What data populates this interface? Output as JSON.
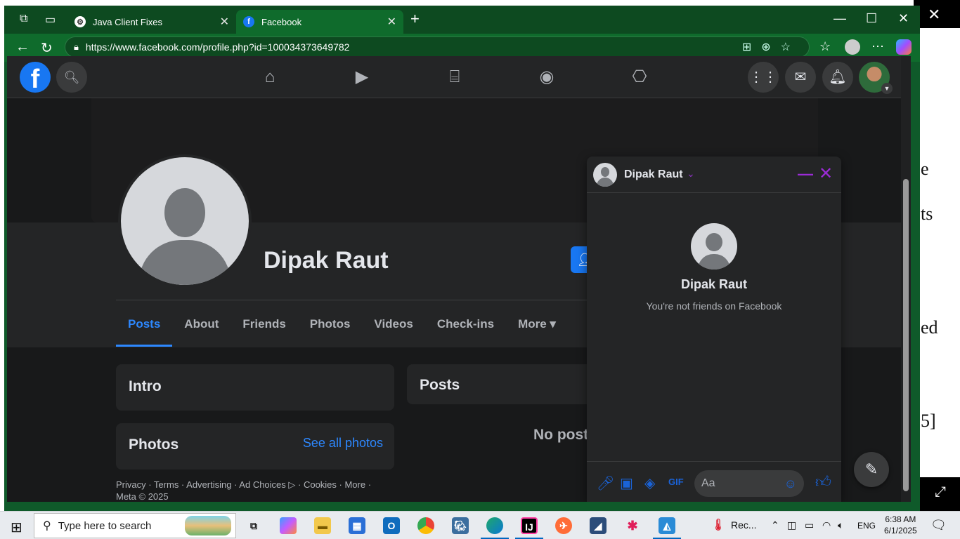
{
  "browser": {
    "tabs": [
      {
        "title": "Java Client Fixes",
        "active": false
      },
      {
        "title": "Facebook",
        "active": true
      }
    ],
    "url": "https://www.facebook.com/profile.php?id=100034373649782"
  },
  "background_doc": {
    "fragments": [
      "e",
      "ts",
      "ed",
      "5]"
    ]
  },
  "facebook": {
    "profile": {
      "name": "Dipak Raut",
      "tabs": [
        "Posts",
        "About",
        "Friends",
        "Photos",
        "Videos",
        "Check-ins",
        "More ▾"
      ]
    },
    "intro": {
      "title": "Intro"
    },
    "photos": {
      "title": "Photos",
      "see_all": "See all photos"
    },
    "posts": {
      "title": "Posts",
      "empty": "No post"
    },
    "footer": {
      "line1": "Privacy · Terms · Advertising · Ad Choices ▷ · Cookies · More ·",
      "line2": "Meta © 2025"
    },
    "chat": {
      "name": "Dipak Raut",
      "big_name": "Dipak Raut",
      "subtitle": "You're not friends on Facebook",
      "input_placeholder": "Aa"
    }
  },
  "taskbar": {
    "search_placeholder": "Type here to search",
    "tray_app_label": "Rec...",
    "language": "ENG",
    "time": "6:38 AM",
    "date": "6/1/2025"
  },
  "colors": {
    "fb_blue": "#1877f2",
    "link_blue": "#2d88ff",
    "chat_accent": "#9b2bd6",
    "browser_green": "#0f6b2c"
  }
}
